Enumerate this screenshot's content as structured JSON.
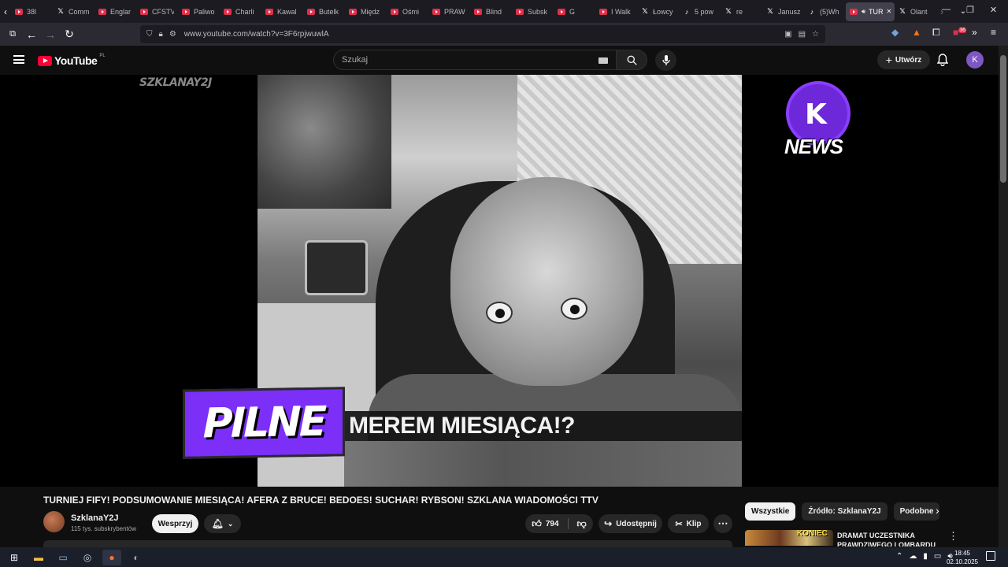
{
  "browser": {
    "tabs": [
      {
        "icon": "youtube-icon",
        "title": "38l"
      },
      {
        "icon": "x-icon",
        "title": "Comm"
      },
      {
        "icon": "youtube-icon",
        "title": "Englar"
      },
      {
        "icon": "youtube-icon",
        "title": "CFSTV"
      },
      {
        "icon": "youtube-icon",
        "title": "Paliwo"
      },
      {
        "icon": "youtube-icon",
        "title": "Charli"
      },
      {
        "icon": "youtube-icon",
        "title": "Kawal"
      },
      {
        "icon": "youtube-icon",
        "title": "Butelk"
      },
      {
        "icon": "youtube-icon",
        "title": "Międz"
      },
      {
        "icon": "youtube-icon",
        "title": "Ośmi"
      },
      {
        "icon": "youtube-icon",
        "title": "PRAW"
      },
      {
        "icon": "youtube-icon",
        "title": "Blind"
      },
      {
        "icon": "youtube-icon",
        "title": "Subsk"
      },
      {
        "icon": "youtube-icon",
        "title": "G"
      },
      {
        "icon": "youtube-icon",
        "title": "I Walk"
      },
      {
        "icon": "x-icon",
        "title": "Łowcy"
      },
      {
        "icon": "tiktok-icon",
        "title": "5 pow"
      },
      {
        "icon": "x-icon",
        "title": "re"
      },
      {
        "icon": "x-icon",
        "title": "Janusz"
      },
      {
        "icon": "tiktok-icon",
        "title": "(5)Wh"
      },
      {
        "icon": "youtube-icon",
        "title": "TUR",
        "active": true
      },
      {
        "icon": "x-icon",
        "title": "Olant"
      }
    ],
    "url": "www.youtube.com/watch?v=3F6rpjwuwlA",
    "extension_badge": "36"
  },
  "yt": {
    "logo_text": "YouTube",
    "country_code": "PL",
    "search_placeholder": "Szukaj",
    "create_label": "Utwórz",
    "avatar_letter": "K"
  },
  "video": {
    "watermark": "SZKLANAY2J",
    "news_badge": "NEWS",
    "news_logo_letter": "K",
    "breaking_label": "PILNE",
    "lower_third": "MEREM MIESIĄCA!?",
    "title": "TURNIEJ FIFY! PODSUMOWANIE MIESIĄCA! AFERA Z BRUCE! BEDOES! SUCHAR! RYBSON! SZKLANA WIADOMOŚCI TTV"
  },
  "channel": {
    "name": "SzklanaY2J",
    "subscribers": "115 tys. subskrybentów",
    "support_label": "Wesprzyj"
  },
  "actions": {
    "likes": "794",
    "share_label": "Udostępnij",
    "clip_label": "Klip"
  },
  "chips": [
    "Wszystkie",
    "Źródło: SzklanaY2J",
    "Podobne"
  ],
  "recommendation": {
    "thumb_text": "KONIEC",
    "title": "DRAMAT UCZESTNIKA PRAWDZIWEGO LOMBARDU"
  },
  "taskbar": {
    "time": "18:45",
    "date": "02.10.2025"
  }
}
